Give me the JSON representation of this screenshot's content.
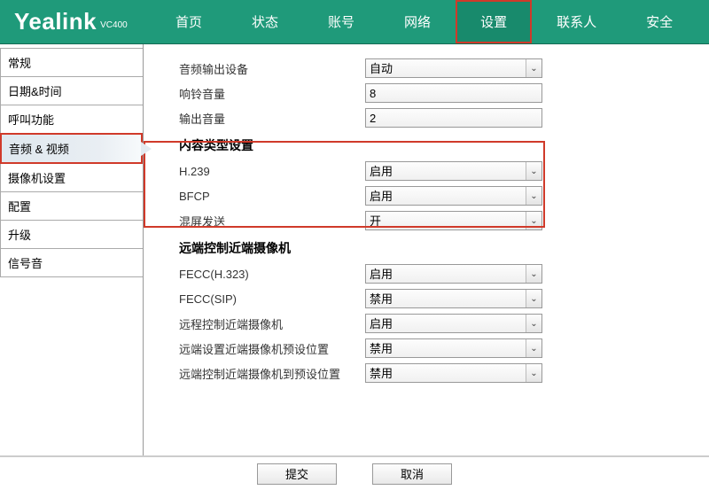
{
  "brand": {
    "main": "Yealink",
    "sub": "VC400"
  },
  "topnav": {
    "items": [
      {
        "label": "首页"
      },
      {
        "label": "状态"
      },
      {
        "label": "账号"
      },
      {
        "label": "网络"
      },
      {
        "label": "设置",
        "active": true
      },
      {
        "label": "联系人"
      },
      {
        "label": "安全"
      }
    ]
  },
  "sidebar": {
    "items": [
      {
        "label": "常规"
      },
      {
        "label": "日期&时间"
      },
      {
        "label": "呼叫功能"
      },
      {
        "label": "音频 & 视频",
        "active": true
      },
      {
        "label": "摄像机设置"
      },
      {
        "label": "配置"
      },
      {
        "label": "升级"
      },
      {
        "label": "信号音"
      }
    ]
  },
  "section1": {
    "audio_output_device": {
      "label": "音频输出设备",
      "value": "自动"
    },
    "ring_volume": {
      "label": "响铃音量",
      "value": "8"
    },
    "output_volume": {
      "label": "输出音量",
      "value": "2"
    }
  },
  "section2": {
    "title": "内容类型设置",
    "h239": {
      "label": "H.239",
      "value": "启用"
    },
    "bfcp": {
      "label": "BFCP",
      "value": "启用"
    },
    "mixed_send": {
      "label": "混屏发送",
      "value": "开"
    }
  },
  "section3": {
    "title": "远端控制近端摄像机",
    "fecc_h323": {
      "label": "FECC(H.323)",
      "value": "启用"
    },
    "fecc_sip": {
      "label": "FECC(SIP)",
      "value": "禁用"
    },
    "remote_ctrl_near": {
      "label": "远程控制近端摄像机",
      "value": "启用"
    },
    "far_set_near_preset": {
      "label": "远端设置近端摄像机预设位置",
      "value": "禁用"
    },
    "far_ctrl_near_to_preset": {
      "label": "远端控制近端摄像机到预设位置",
      "value": "禁用"
    }
  },
  "footer": {
    "submit": "提交",
    "cancel": "取消"
  }
}
